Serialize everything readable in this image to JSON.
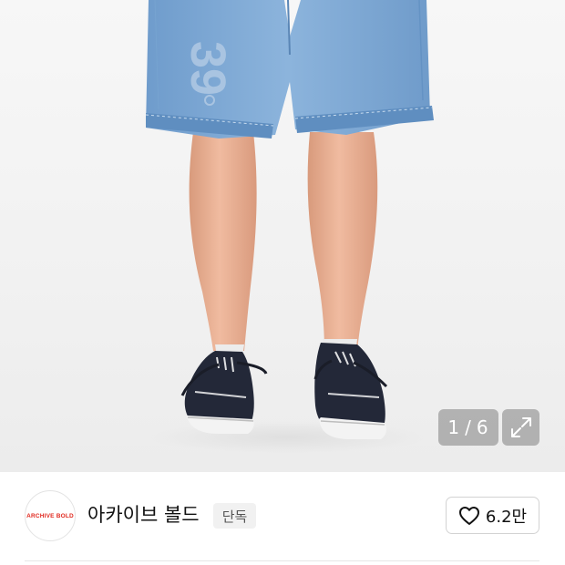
{
  "gallery": {
    "current_index": "1",
    "separator": "/",
    "total": "6",
    "shorts_print": "39"
  },
  "icons": {
    "expand": "expand-icon",
    "heart": "heart-outline-icon"
  },
  "brand": {
    "logo_text": "ARCHIVE BOLD",
    "name": "아카이브 볼드",
    "badge": "단독",
    "logo_color": "#e0281e"
  },
  "like": {
    "count": "6.2만"
  }
}
